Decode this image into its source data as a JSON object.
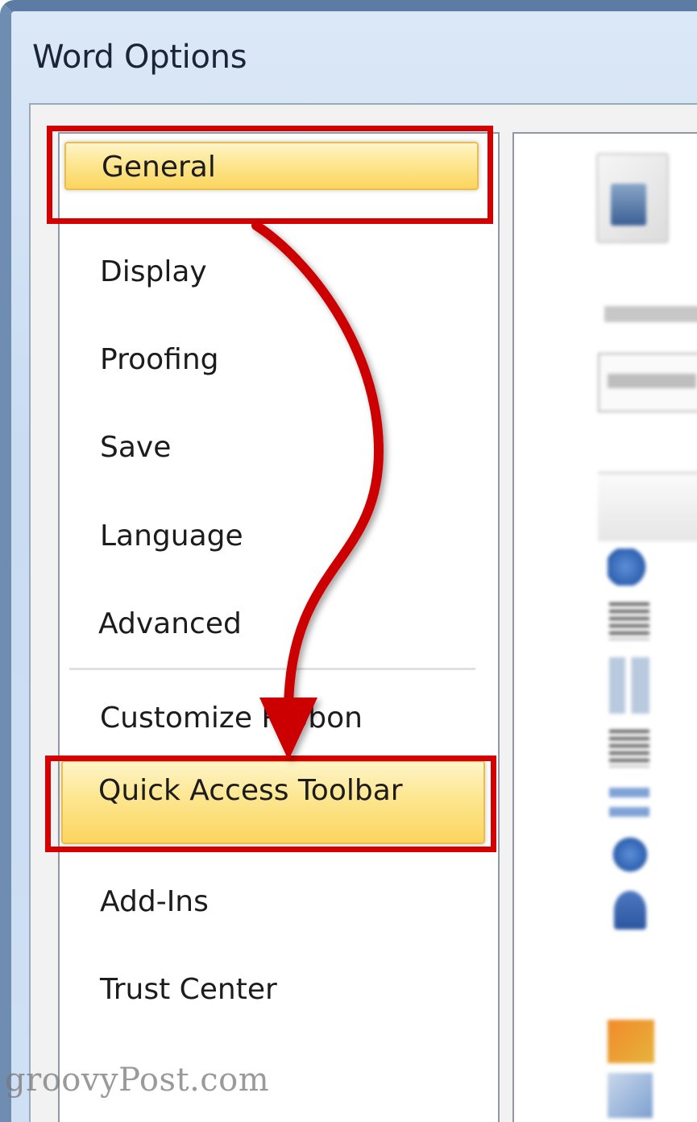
{
  "window": {
    "title": "Word Options"
  },
  "nav": {
    "items": [
      {
        "label": "General",
        "selected": true
      },
      {
        "label": "Display",
        "selected": false
      },
      {
        "label": "Proofing",
        "selected": false
      },
      {
        "label": "Save",
        "selected": false
      },
      {
        "label": "Language",
        "selected": false
      },
      {
        "label": "Advanced",
        "selected": false
      },
      {
        "label": "Customize Ribbon",
        "selected": false
      },
      {
        "label": "Quick Access Toolbar",
        "selected": true
      },
      {
        "label": "Add-Ins",
        "selected": false
      },
      {
        "label": "Trust Center",
        "selected": false
      }
    ]
  },
  "annotations": {
    "highlight_color": "#d40000",
    "arrow_from": "General",
    "arrow_to": "Quick Access Toolbar"
  },
  "watermark": "groovyPost.com"
}
